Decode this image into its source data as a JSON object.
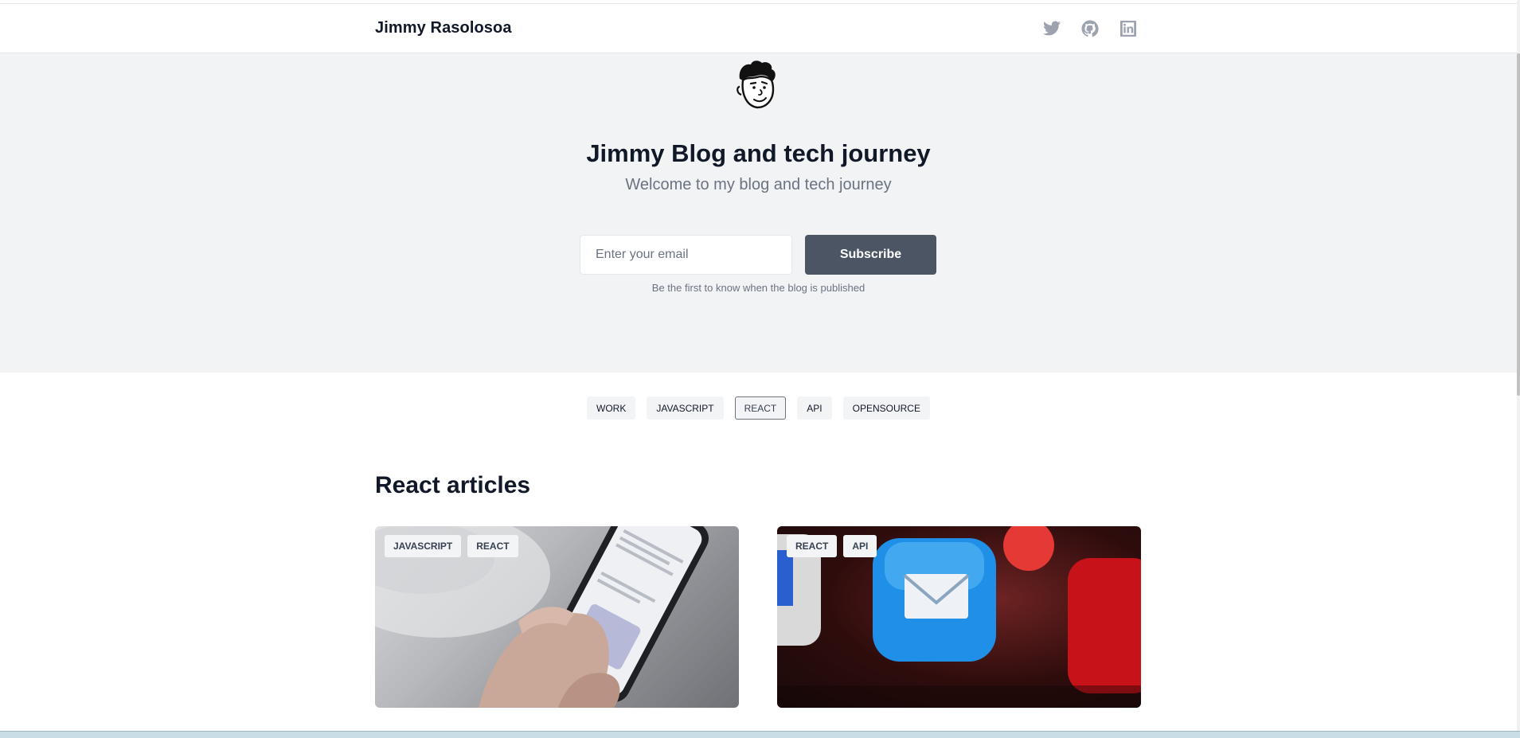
{
  "navbar": {
    "brand": "Jimmy Rasolosoa",
    "socials": [
      {
        "icon": "twitter-icon"
      },
      {
        "icon": "github-icon"
      },
      {
        "icon": "linkedin-icon"
      }
    ]
  },
  "hero": {
    "title": "Jimmy Blog and tech journey",
    "subtitle": "Welcome to my blog and tech journey",
    "email_placeholder": "Enter your email",
    "email_value": "",
    "subscribe_label": "Subscribe",
    "hint": "Be the first to know when the blog is published"
  },
  "filters": {
    "tags": [
      "WORK",
      "JAVASCRIPT",
      "REACT",
      "API",
      "OPENSOURCE"
    ],
    "active": "REACT"
  },
  "section": {
    "title": "React articles"
  },
  "articles": [
    {
      "tags": [
        "JAVASCRIPT",
        "REACT"
      ],
      "image": "phone-in-hand-twitter"
    },
    {
      "tags": [
        "REACT",
        "API"
      ],
      "image": "mail-app-notification"
    }
  ],
  "colors": {
    "hero_bg": "#f2f3f5",
    "button_bg": "#4b5563",
    "tag_bg": "#f3f4f6",
    "icon_gray": "#9ca3af",
    "text_dark": "#111827",
    "text_muted": "#6b7280"
  }
}
